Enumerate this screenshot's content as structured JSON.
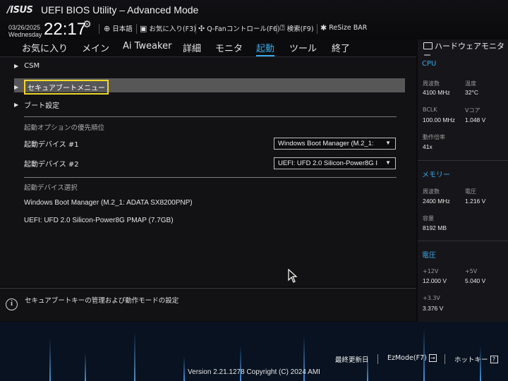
{
  "header": {
    "logo": "/ISUS",
    "title": "UEFI BIOS Utility – Advanced Mode",
    "date": "03/26/2025",
    "day": "Wednesday",
    "time": "22:17",
    "items": {
      "language": "日本語",
      "favorites": "お気に入り(F3)",
      "qfan": "Q-Fanコントロール(F6)",
      "search": "検索(F9)",
      "resize_bar": "ReSize BAR"
    }
  },
  "tabs": [
    {
      "label": "お気に入り"
    },
    {
      "label": "メイン"
    },
    {
      "label": "Ai Tweaker"
    },
    {
      "label": "詳細"
    },
    {
      "label": "モニタ"
    },
    {
      "label": "起動",
      "active": true
    },
    {
      "label": "ツール"
    },
    {
      "label": "終了"
    }
  ],
  "main": {
    "submenus": {
      "csm": "CSM",
      "secure_boot": "セキュアブートメニュー",
      "boot_config": "ブート設定"
    },
    "boot_priority": {
      "section_label": "起動オプションの優先順位",
      "device1_label": "起動デバイス #1",
      "device1_value": "Windows Boot Manager (M.2_1:",
      "device2_label": "起動デバイス #2",
      "device2_value": "UEFI: UFD 2.0 Silicon-Power8G I"
    },
    "boot_override": {
      "section_label": "起動デバイス選択",
      "items": [
        "Windows Boot Manager (M.2_1: ADATA SX8200PNP)",
        "UEFI: UFD 2.0 Silicon-Power8G PMAP (7.7GB)"
      ]
    },
    "help_text": "セキュアブートキーの管理および動作モードの設定"
  },
  "hardware_monitor": {
    "title": "ハードウェアモニター",
    "cpu": {
      "section": "CPU",
      "freq_label": "周波数",
      "freq_value": "4100 MHz",
      "temp_label": "温度",
      "temp_value": "32°C",
      "bclk_label": "BCLK",
      "bclk_value": "100.00 MHz",
      "vcore_label": "Vコア",
      "vcore_value": "1.048 V",
      "ratio_label": "動作倍率",
      "ratio_value": "41x"
    },
    "memory": {
      "section": "メモリー",
      "freq_label": "周波数",
      "freq_value": "2400 MHz",
      "volt_label": "電圧",
      "volt_value": "1.216 V",
      "cap_label": "容量",
      "cap_value": "8192 MB"
    },
    "voltage": {
      "section": "電圧",
      "v12_label": "+12V",
      "v12_value": "12.000 V",
      "v5_label": "+5V",
      "v5_value": "5.040 V",
      "v33_label": "+3.3V",
      "v33_value": "3.376 V"
    }
  },
  "footer": {
    "last_modified": "最終更新日",
    "ezmode": "EzMode(F7)",
    "hotkeys": "ホットキー",
    "hotkeys_icon_text": "?",
    "copyright": "Version 2.21.1278 Copyright (C) 2024 AMI"
  },
  "colors": {
    "accent": "#3aa8e8",
    "selection_border": "#f1d72a",
    "highlight_row": "#575757"
  }
}
